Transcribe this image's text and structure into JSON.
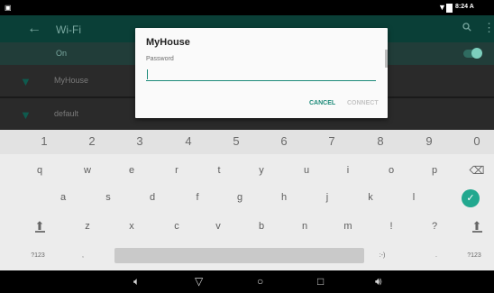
{
  "status_bar": {
    "time": "8:24 A",
    "notification_icon": "notification-icon",
    "wifi_icon": "wifi-icon",
    "battery_icon": "battery-icon"
  },
  "toolbar": {
    "back_icon": "arrow-left-icon",
    "title": "Wi-Fi",
    "search_icon": "search-icon",
    "more_icon": "more-vert-icon"
  },
  "master": {
    "label": "On",
    "switch_on": true
  },
  "networks": [
    {
      "name": "MyHouse",
      "icon": "wifi-signal-icon"
    },
    {
      "name": "default",
      "icon": "wifi-signal-icon"
    }
  ],
  "dialog": {
    "title": "MyHouse",
    "password_label": "Password",
    "password_value": "",
    "cancel_label": "CANCEL",
    "connect_label": "CONNECT"
  },
  "keyboard": {
    "numbers": [
      "1",
      "2",
      "3",
      "4",
      "5",
      "6",
      "7",
      "8",
      "9",
      "0"
    ],
    "row2": [
      "q",
      "w",
      "e",
      "r",
      "t",
      "y",
      "u",
      "i",
      "o",
      "p"
    ],
    "row3": [
      "a",
      "s",
      "d",
      "f",
      "g",
      "h",
      "j",
      "k",
      "l"
    ],
    "row4": [
      "z",
      "x",
      "c",
      "v",
      "b",
      "n",
      "m",
      "!",
      "?"
    ],
    "sym_left": "?123",
    "comma": ",",
    "emoji": ":-)",
    "period": ".",
    "sym_right": "?123",
    "accent_color": "#22a88f"
  },
  "nav_bar": {
    "volume_down_icon": "volume-down-icon",
    "back_icon": "back-triangle-icon",
    "home_icon": "home-circle-icon",
    "recents_icon": "recents-square-icon",
    "volume_up_icon": "volume-up-icon"
  }
}
